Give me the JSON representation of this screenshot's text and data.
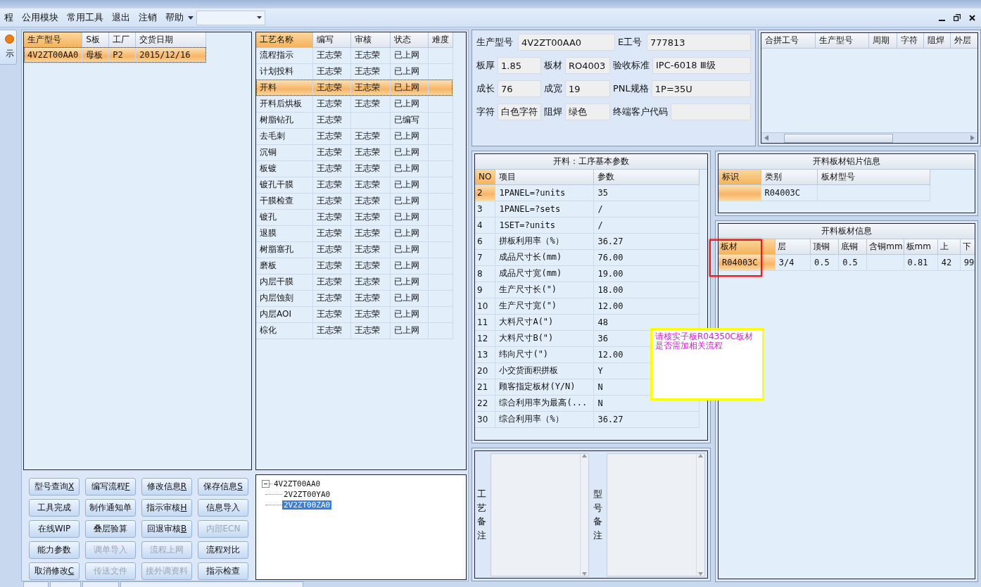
{
  "menu": [
    {
      "label": "程"
    },
    {
      "label": "公用模块"
    },
    {
      "label": "常用工具"
    },
    {
      "label": "退出"
    },
    {
      "label": "注销"
    },
    {
      "label": "帮助"
    }
  ],
  "side_button": {
    "label": "示"
  },
  "order_table": {
    "columns": [
      "生产型号",
      "S板",
      "工厂",
      "交货日期"
    ],
    "rows": [
      {
        "cells": [
          "4V2ZT00AA0",
          "母板",
          "P2",
          "2015/12/16"
        ],
        "selected": true
      }
    ]
  },
  "process_table": {
    "columns": [
      "工艺名称",
      "编写",
      "审核",
      "状态",
      "难度"
    ],
    "rows": [
      {
        "name": "流程指示",
        "author": "王志荣",
        "reviewer": "王志荣",
        "status": "已上网",
        "selected": false
      },
      {
        "name": "计划投料",
        "author": "王志荣",
        "reviewer": "王志荣",
        "status": "已上网",
        "selected": false
      },
      {
        "name": "开料",
        "author": "王志荣",
        "reviewer": "王志荣",
        "status": "已上网",
        "selected": true
      },
      {
        "name": "开料后烘板",
        "author": "王志荣",
        "reviewer": "王志荣",
        "status": "已上网",
        "selected": false
      },
      {
        "name": "树脂钻孔",
        "author": "王志荣",
        "status": "已编写",
        "selected": false
      },
      {
        "name": "去毛刺",
        "author": "王志荣",
        "reviewer": "王志荣",
        "status": "已上网",
        "selected": false
      },
      {
        "name": "沉铜",
        "author": "王志荣",
        "reviewer": "王志荣",
        "status": "已上网",
        "selected": false
      },
      {
        "name": "板镀",
        "author": "王志荣",
        "reviewer": "王志荣",
        "status": "已上网",
        "selected": false
      },
      {
        "name": "镀孔干膜",
        "author": "王志荣",
        "reviewer": "王志荣",
        "status": "已上网",
        "selected": false
      },
      {
        "name": "干膜检查",
        "author": "王志荣",
        "reviewer": "王志荣",
        "status": "已上网",
        "selected": false
      },
      {
        "name": "镀孔",
        "author": "王志荣",
        "reviewer": "王志荣",
        "status": "已上网",
        "selected": false
      },
      {
        "name": "退膜",
        "author": "王志荣",
        "reviewer": "王志荣",
        "status": "已上网",
        "selected": false
      },
      {
        "name": "树脂塞孔",
        "author": "王志荣",
        "reviewer": "王志荣",
        "status": "已上网",
        "selected": false
      },
      {
        "name": "磨板",
        "author": "王志荣",
        "reviewer": "王志荣",
        "status": "已上网",
        "selected": false
      },
      {
        "name": "内层干膜",
        "author": "王志荣",
        "reviewer": "王志荣",
        "status": "已上网",
        "selected": false
      },
      {
        "name": "内层蚀刻",
        "author": "王志荣",
        "reviewer": "王志荣",
        "status": "已上网",
        "selected": false
      },
      {
        "name": "内层AOI",
        "author": "王志荣",
        "reviewer": "王志荣",
        "status": "已上网",
        "selected": false
      },
      {
        "name": "棕化",
        "author": "王志荣",
        "reviewer": "王志荣",
        "status": "已上网",
        "selected": false
      }
    ]
  },
  "buttons": [
    {
      "label": "型号查询",
      "hotkey": "X",
      "disabled": false
    },
    {
      "label": "编写流程",
      "hotkey": "F",
      "disabled": false
    },
    {
      "label": "修改信息",
      "hotkey": "R",
      "disabled": false
    },
    {
      "label": "保存信息",
      "hotkey": "S",
      "disabled": false
    },
    {
      "label": "工具完成",
      "disabled": false
    },
    {
      "label": "制作通知单",
      "disabled": false
    },
    {
      "label": "指示审核",
      "hotkey": "H",
      "disabled": false
    },
    {
      "label": "信息导入",
      "disabled": false
    },
    {
      "label": "在线WIP",
      "disabled": false
    },
    {
      "label": "叠层验算",
      "disabled": false
    },
    {
      "label": "回退审核",
      "hotkey": "B",
      "disabled": false
    },
    {
      "label": "内部ECN",
      "disabled": true
    },
    {
      "label": "能力参数",
      "disabled": false
    },
    {
      "label": "调单导入",
      "disabled": true
    },
    {
      "label": "流程上网",
      "disabled": true
    },
    {
      "label": "流程对比",
      "disabled": false
    },
    {
      "label": "取消修改",
      "hotkey": "C",
      "disabled": false
    },
    {
      "label": "传送文件",
      "disabled": true
    },
    {
      "label": "接外调资料",
      "disabled": true
    },
    {
      "label": "指示检查",
      "disabled": false
    }
  ],
  "tree": {
    "label": "4V2ZT00AA0",
    "expanded": true,
    "children": [
      {
        "label": "2V2ZT00YA0",
        "selected": false
      },
      {
        "label": "2V2ZT00ZA0",
        "selected": true
      }
    ]
  },
  "info_rows": [
    [
      {
        "label": "生产型号",
        "value": "4V2ZT00AA0"
      },
      {
        "label": "E工号",
        "value": "777813"
      }
    ],
    [
      {
        "label": "板厚",
        "value": "1.85"
      },
      {
        "label": "板材",
        "value": "RO4003"
      },
      {
        "label": "验收标准",
        "value": "IPC-6018 Ⅲ级"
      }
    ],
    [
      {
        "label": "成长",
        "value": "76"
      },
      {
        "label": "成宽",
        "value": "19"
      },
      {
        "label": "PNL规格",
        "value": "1P=35U"
      }
    ],
    [
      {
        "label": "字符",
        "value": "白色字符"
      },
      {
        "label": "阻焊",
        "value": "绿色"
      },
      {
        "label": "终端客户代码"
      }
    ]
  ],
  "merge_table": {
    "columns": [
      "合拼工号",
      "生产型号",
      "周期",
      "字符",
      "阻焊",
      "外层"
    ]
  },
  "params": {
    "title": "开料：工序基本参数",
    "columns": [
      "NO",
      "项目",
      "参数"
    ],
    "rows": [
      {
        "no": "2",
        "item": "1PANEL=?units",
        "value": "35",
        "selected": true
      },
      {
        "no": "3",
        "item": "1PANEL=?sets",
        "value": "/",
        "selected": false
      },
      {
        "no": "4",
        "item": "1SET=?units",
        "value": "/",
        "selected": false
      },
      {
        "no": "6",
        "item": "拼板利用率（%）",
        "value": "36.27",
        "selected": false
      },
      {
        "no": "7",
        "item": "成品尺寸长(mm)",
        "value": "76.00",
        "selected": false
      },
      {
        "no": "8",
        "item": "成品尺寸宽(mm)",
        "value": "19.00",
        "selected": false
      },
      {
        "no": "9",
        "item": "生产尺寸长(\")",
        "value": "18.00",
        "selected": false
      },
      {
        "no": "10",
        "item": "生产尺寸宽(\")",
        "value": "12.00",
        "selected": false
      },
      {
        "no": "11",
        "item": "大料尺寸A(\")",
        "value": "48",
        "selected": false
      },
      {
        "no": "12",
        "item": "大料尺寸B(\")",
        "value": "36",
        "selected": false
      },
      {
        "no": "13",
        "item": "纬向尺寸(\")",
        "value": "12.00",
        "selected": false
      },
      {
        "no": "20",
        "item": "小交货面积拼板",
        "value": "Y",
        "selected": false
      },
      {
        "no": "21",
        "item": "顾客指定板材(Y/N)",
        "value": "N",
        "selected": false
      },
      {
        "no": "22",
        "item": "综合利用率为最高(...",
        "value": "N",
        "selected": false
      },
      {
        "no": "30",
        "item": "综合利用率（%）",
        "value": "36.27",
        "selected": false
      }
    ]
  },
  "notes": [
    {
      "label": "工艺备注"
    },
    {
      "label": "型号备注"
    }
  ],
  "aluminum": {
    "title": "开料板材铝片信息",
    "columns": [
      "标识",
      "类别",
      "板材型号"
    ],
    "rows": [
      {
        "category": "R04003C",
        "selected": true
      }
    ]
  },
  "board": {
    "title": "开料板材信息",
    "columns": [
      "板材",
      "层",
      "顶铜",
      "底铜",
      "含铜mm",
      "板mm",
      "上",
      "下"
    ],
    "rows": [
      {
        "cells": [
          "R04003C",
          "3/4",
          "0.5",
          "0.5",
          null,
          "0.81",
          "42",
          "99"
        ],
        "selected": true,
        "marked": true
      }
    ]
  },
  "callout": {
    "text": "请核实子板R04350C板材是否需加相关流程"
  }
}
